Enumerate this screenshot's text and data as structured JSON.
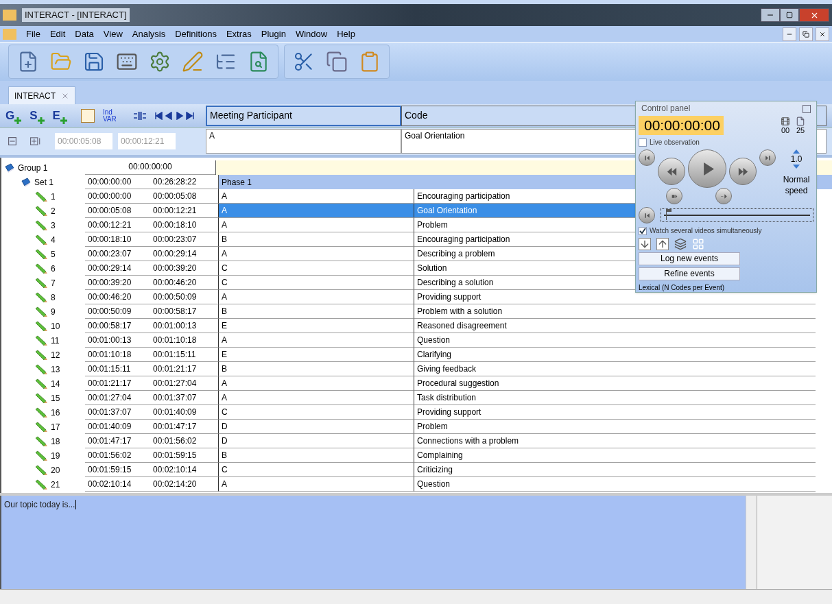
{
  "window": {
    "title": "INTERACT - [INTERACT]"
  },
  "menu": [
    {
      "label": "File"
    },
    {
      "label": "Edit"
    },
    {
      "label": "Data"
    },
    {
      "label": "View"
    },
    {
      "label": "Analysis"
    },
    {
      "label": "Definitions"
    },
    {
      "label": "Extras"
    },
    {
      "label": "Plugin"
    },
    {
      "label": "Window"
    },
    {
      "label": "Help"
    }
  ],
  "tab": {
    "label": "INTERACT",
    "selected": true
  },
  "level_buttons": [
    "G",
    "S",
    "E"
  ],
  "ind_var_button": "Ind VAR",
  "columns": [
    "Meeting Participant",
    "Code"
  ],
  "edit_row": {
    "start": "00:00:05:08",
    "end": "00:00:12:21",
    "participant": "A",
    "code": "Goal Orientation"
  },
  "tree": [
    {
      "label": "Group 1",
      "start": "00:00:00:00",
      "children": [
        {
          "label": "Set 1",
          "start": "00:00:00:00",
          "end": "00:26:28:22",
          "phase": "Phase 1",
          "children": [
            {
              "label": "1",
              "start": "00:00:00:00",
              "end": "00:00:05:08",
              "participant": "A",
              "code": "Encouraging participation",
              "selected": false
            },
            {
              "label": "2",
              "start": "00:00:05:08",
              "end": "00:00:12:21",
              "participant": "A",
              "code": "Goal Orientation",
              "selected": true
            },
            {
              "label": "3",
              "start": "00:00:12:21",
              "end": "00:00:18:10",
              "participant": "A",
              "code": "Problem",
              "selected": false
            },
            {
              "label": "4",
              "start": "00:00:18:10",
              "end": "00:00:23:07",
              "participant": "B",
              "code": "Encouraging participation",
              "selected": false
            },
            {
              "label": "5",
              "start": "00:00:23:07",
              "end": "00:00:29:14",
              "participant": "A",
              "code": "Describing a problem",
              "selected": false
            },
            {
              "label": "6",
              "start": "00:00:29:14",
              "end": "00:00:39:20",
              "participant": "C",
              "code": "Solution",
              "selected": false
            },
            {
              "label": "7",
              "start": "00:00:39:20",
              "end": "00:00:46:20",
              "participant": "C",
              "code": "Describing a solution",
              "selected": false
            },
            {
              "label": "8",
              "start": "00:00:46:20",
              "end": "00:00:50:09",
              "participant": "A",
              "code": "Providing support",
              "selected": false
            },
            {
              "label": "9",
              "start": "00:00:50:09",
              "end": "00:00:58:17",
              "participant": "B",
              "code": "Problem with a solution",
              "selected": false
            },
            {
              "label": "10",
              "start": "00:00:58:17",
              "end": "00:01:00:13",
              "participant": "E",
              "code": "Reasoned disagreement",
              "selected": false
            },
            {
              "label": "11",
              "start": "00:01:00:13",
              "end": "00:01:10:18",
              "participant": "A",
              "code": "Question",
              "selected": false
            },
            {
              "label": "12",
              "start": "00:01:10:18",
              "end": "00:01:15:11",
              "participant": "E",
              "code": "Clarifying",
              "selected": false
            },
            {
              "label": "13",
              "start": "00:01:15:11",
              "end": "00:01:21:17",
              "participant": "B",
              "code": "Giving feedback",
              "selected": false
            },
            {
              "label": "14",
              "start": "00:01:21:17",
              "end": "00:01:27:04",
              "participant": "A",
              "code": "Procedural suggestion",
              "selected": false
            },
            {
              "label": "15",
              "start": "00:01:27:04",
              "end": "00:01:37:07",
              "participant": "A",
              "code": "Task distribution",
              "selected": false
            },
            {
              "label": "16",
              "start": "00:01:37:07",
              "end": "00:01:40:09",
              "participant": "C",
              "code": "Providing support",
              "selected": false
            },
            {
              "label": "17",
              "start": "00:01:40:09",
              "end": "00:01:47:17",
              "participant": "D",
              "code": "Problem",
              "selected": false
            },
            {
              "label": "18",
              "start": "00:01:47:17",
              "end": "00:01:56:02",
              "participant": "D",
              "code": "Connections with a problem",
              "selected": false
            },
            {
              "label": "19",
              "start": "00:01:56:02",
              "end": "00:01:59:15",
              "participant": "B",
              "code": "Complaining",
              "selected": false
            },
            {
              "label": "20",
              "start": "00:01:59:15",
              "end": "00:02:10:14",
              "participant": "C",
              "code": "Criticizing",
              "selected": false
            },
            {
              "label": "21",
              "start": "00:02:10:14",
              "end": "00:02:14:20",
              "participant": "A",
              "code": "Question",
              "selected": false
            }
          ]
        }
      ]
    }
  ],
  "notes": {
    "value": "Our topic today is..."
  },
  "control_panel": {
    "title": "Control panel",
    "time": "00:00:00:00",
    "video_count": "00",
    "frame_rate": "25",
    "live_observation": {
      "label": "Live observation",
      "checked": false
    },
    "speed": "1.0",
    "speed_label": "Normal speed",
    "position": {
      "level": 0.03
    },
    "watch_several": {
      "label": "Watch several videos simultaneously",
      "checked": true
    },
    "buttons": [
      "Log new events",
      "Refine events"
    ],
    "mode": "Lexical (N Codes per Event)"
  }
}
